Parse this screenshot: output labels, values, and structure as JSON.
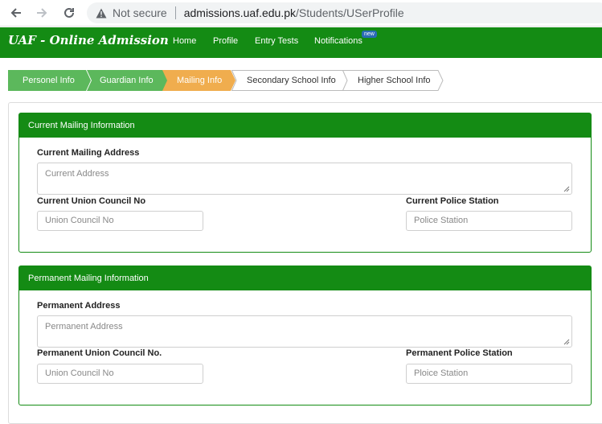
{
  "browser": {
    "not_secure": "Not secure",
    "url_host": "admissions.uaf.edu.pk",
    "url_path": "/Students/USerProfile",
    "back_icon": "arrow-left-icon",
    "forward_icon": "arrow-right-icon",
    "reload_icon": "reload-icon",
    "warning_icon": "warning-triangle-icon"
  },
  "navbar": {
    "brand": "UAF - Online Admission",
    "links": [
      "Home",
      "Profile",
      "Entry Tests",
      "Notifications"
    ],
    "badge": "new",
    "color": "#148b14"
  },
  "steps": [
    {
      "label": "Personel Info",
      "state": "done",
      "color": "#5cb85c"
    },
    {
      "label": "Guardian Info",
      "state": "done",
      "color": "#5cb85c"
    },
    {
      "label": "Mailing Info",
      "state": "active",
      "color": "#f0ad4e"
    },
    {
      "label": "Secondary School Info",
      "state": "pending",
      "color": "#ffffff"
    },
    {
      "label": "Higher School Info",
      "state": "pending",
      "color": "#ffffff"
    }
  ],
  "current": {
    "heading": "Current Mailing Information",
    "address_label": "Current Mailing Address",
    "address_placeholder": "Current Address",
    "union_label": "Current Union Council No",
    "union_placeholder": "Union Council No",
    "police_label": "Current Police Station",
    "police_placeholder": "Police Station"
  },
  "permanent": {
    "heading": "Permanent Mailing Information",
    "address_label": "Permanent Address",
    "address_placeholder": "Permanent Address",
    "union_label": "Permanent Union Council No.",
    "union_placeholder": "Union Council No",
    "police_label": "Permanent Police Station",
    "police_placeholder": "Ploice Station"
  }
}
